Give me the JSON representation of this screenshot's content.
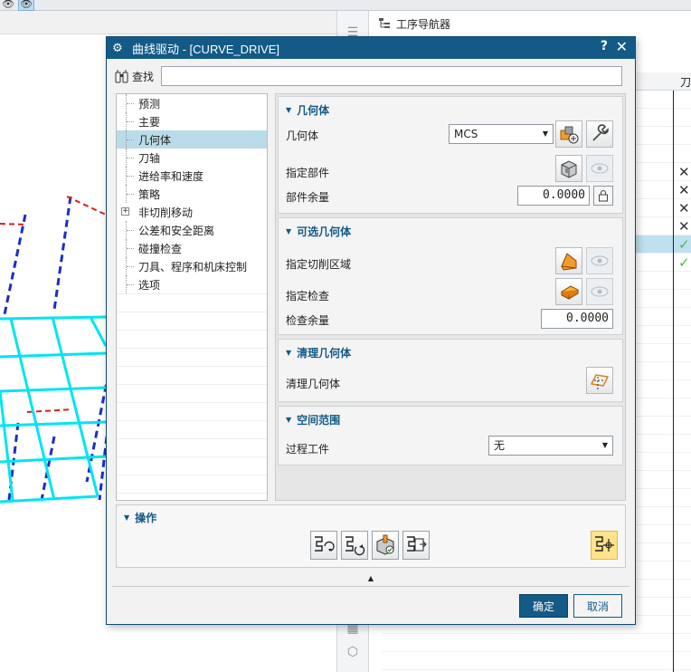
{
  "toolbar": {
    "icons": [
      "eye-icon",
      "eye-toggle-icon"
    ]
  },
  "navigator": {
    "title": "工序导航器",
    "column_header": "刀",
    "rows": [
      {
        "mark": ""
      },
      {
        "mark": ""
      },
      {
        "mark": ""
      },
      {
        "mark": ""
      },
      {
        "mark": "✕"
      },
      {
        "mark": "✕"
      },
      {
        "mark": "✕"
      },
      {
        "mark": "✕"
      },
      {
        "mark": "✓",
        "selected": true
      },
      {
        "mark": "✓"
      },
      {
        "mark": ""
      },
      {
        "mark": ""
      },
      {
        "mark": ""
      },
      {
        "mark": ""
      },
      {
        "mark": ""
      },
      {
        "mark": ""
      },
      {
        "mark": ""
      },
      {
        "mark": ""
      },
      {
        "mark": ""
      },
      {
        "mark": ""
      },
      {
        "mark": ""
      },
      {
        "mark": ""
      },
      {
        "mark": ""
      },
      {
        "mark": ""
      },
      {
        "mark": ""
      },
      {
        "mark": ""
      },
      {
        "mark": ""
      },
      {
        "mark": ""
      },
      {
        "mark": ""
      },
      {
        "mark": ""
      },
      {
        "mark": ""
      },
      {
        "mark": ""
      }
    ],
    "colors": {
      "selected_row": "#bfe0ee",
      "check": "#3fbf3f"
    }
  },
  "dialog": {
    "title": "曲线驱动 - [CURVE_DRIVE]",
    "help": "?",
    "close": "✕",
    "find": {
      "label": "查找",
      "value": ""
    },
    "tree": [
      {
        "label": "预测"
      },
      {
        "label": "主要"
      },
      {
        "label": "几何体",
        "selected": true
      },
      {
        "label": "刀轴"
      },
      {
        "label": "进给率和速度"
      },
      {
        "label": "策略"
      },
      {
        "label": "非切削移动",
        "expandable": true
      },
      {
        "label": "公差和安全距离"
      },
      {
        "label": "碰撞检查"
      },
      {
        "label": "刀具、程序和机床控制"
      },
      {
        "label": "选项"
      }
    ],
    "groups": {
      "geometry": {
        "title": "几何体",
        "geometry_label": "几何体",
        "geometry_value": "MCS",
        "part_label": "指定部件",
        "stock_label": "部件余量",
        "stock_value": "0.0000"
      },
      "optional": {
        "title": "可选几何体",
        "cut_area_label": "指定切削区域",
        "check_label": "指定检查",
        "check_stock_label": "检查余量",
        "check_stock_value": "0.0000"
      },
      "cleanup": {
        "title": "清理几何体",
        "cleanup_label": "清理几何体"
      },
      "spatial": {
        "title": "空间范围",
        "ipw_label": "过程工件",
        "ipw_value": "无"
      }
    },
    "operations": {
      "title": "操作",
      "buttons": [
        "generate-icon",
        "replay-icon",
        "verify-icon",
        "list-icon",
        "assign-icon"
      ]
    },
    "ok": "确定",
    "cancel": "取消",
    "colors": {
      "titlebar": "#135a87",
      "accent": "#135a87",
      "highlight": "#ffe38a",
      "path_cyan": "#00e5f0",
      "path_blue": "#1a2ec8",
      "path_red": "#d81f1f"
    }
  }
}
